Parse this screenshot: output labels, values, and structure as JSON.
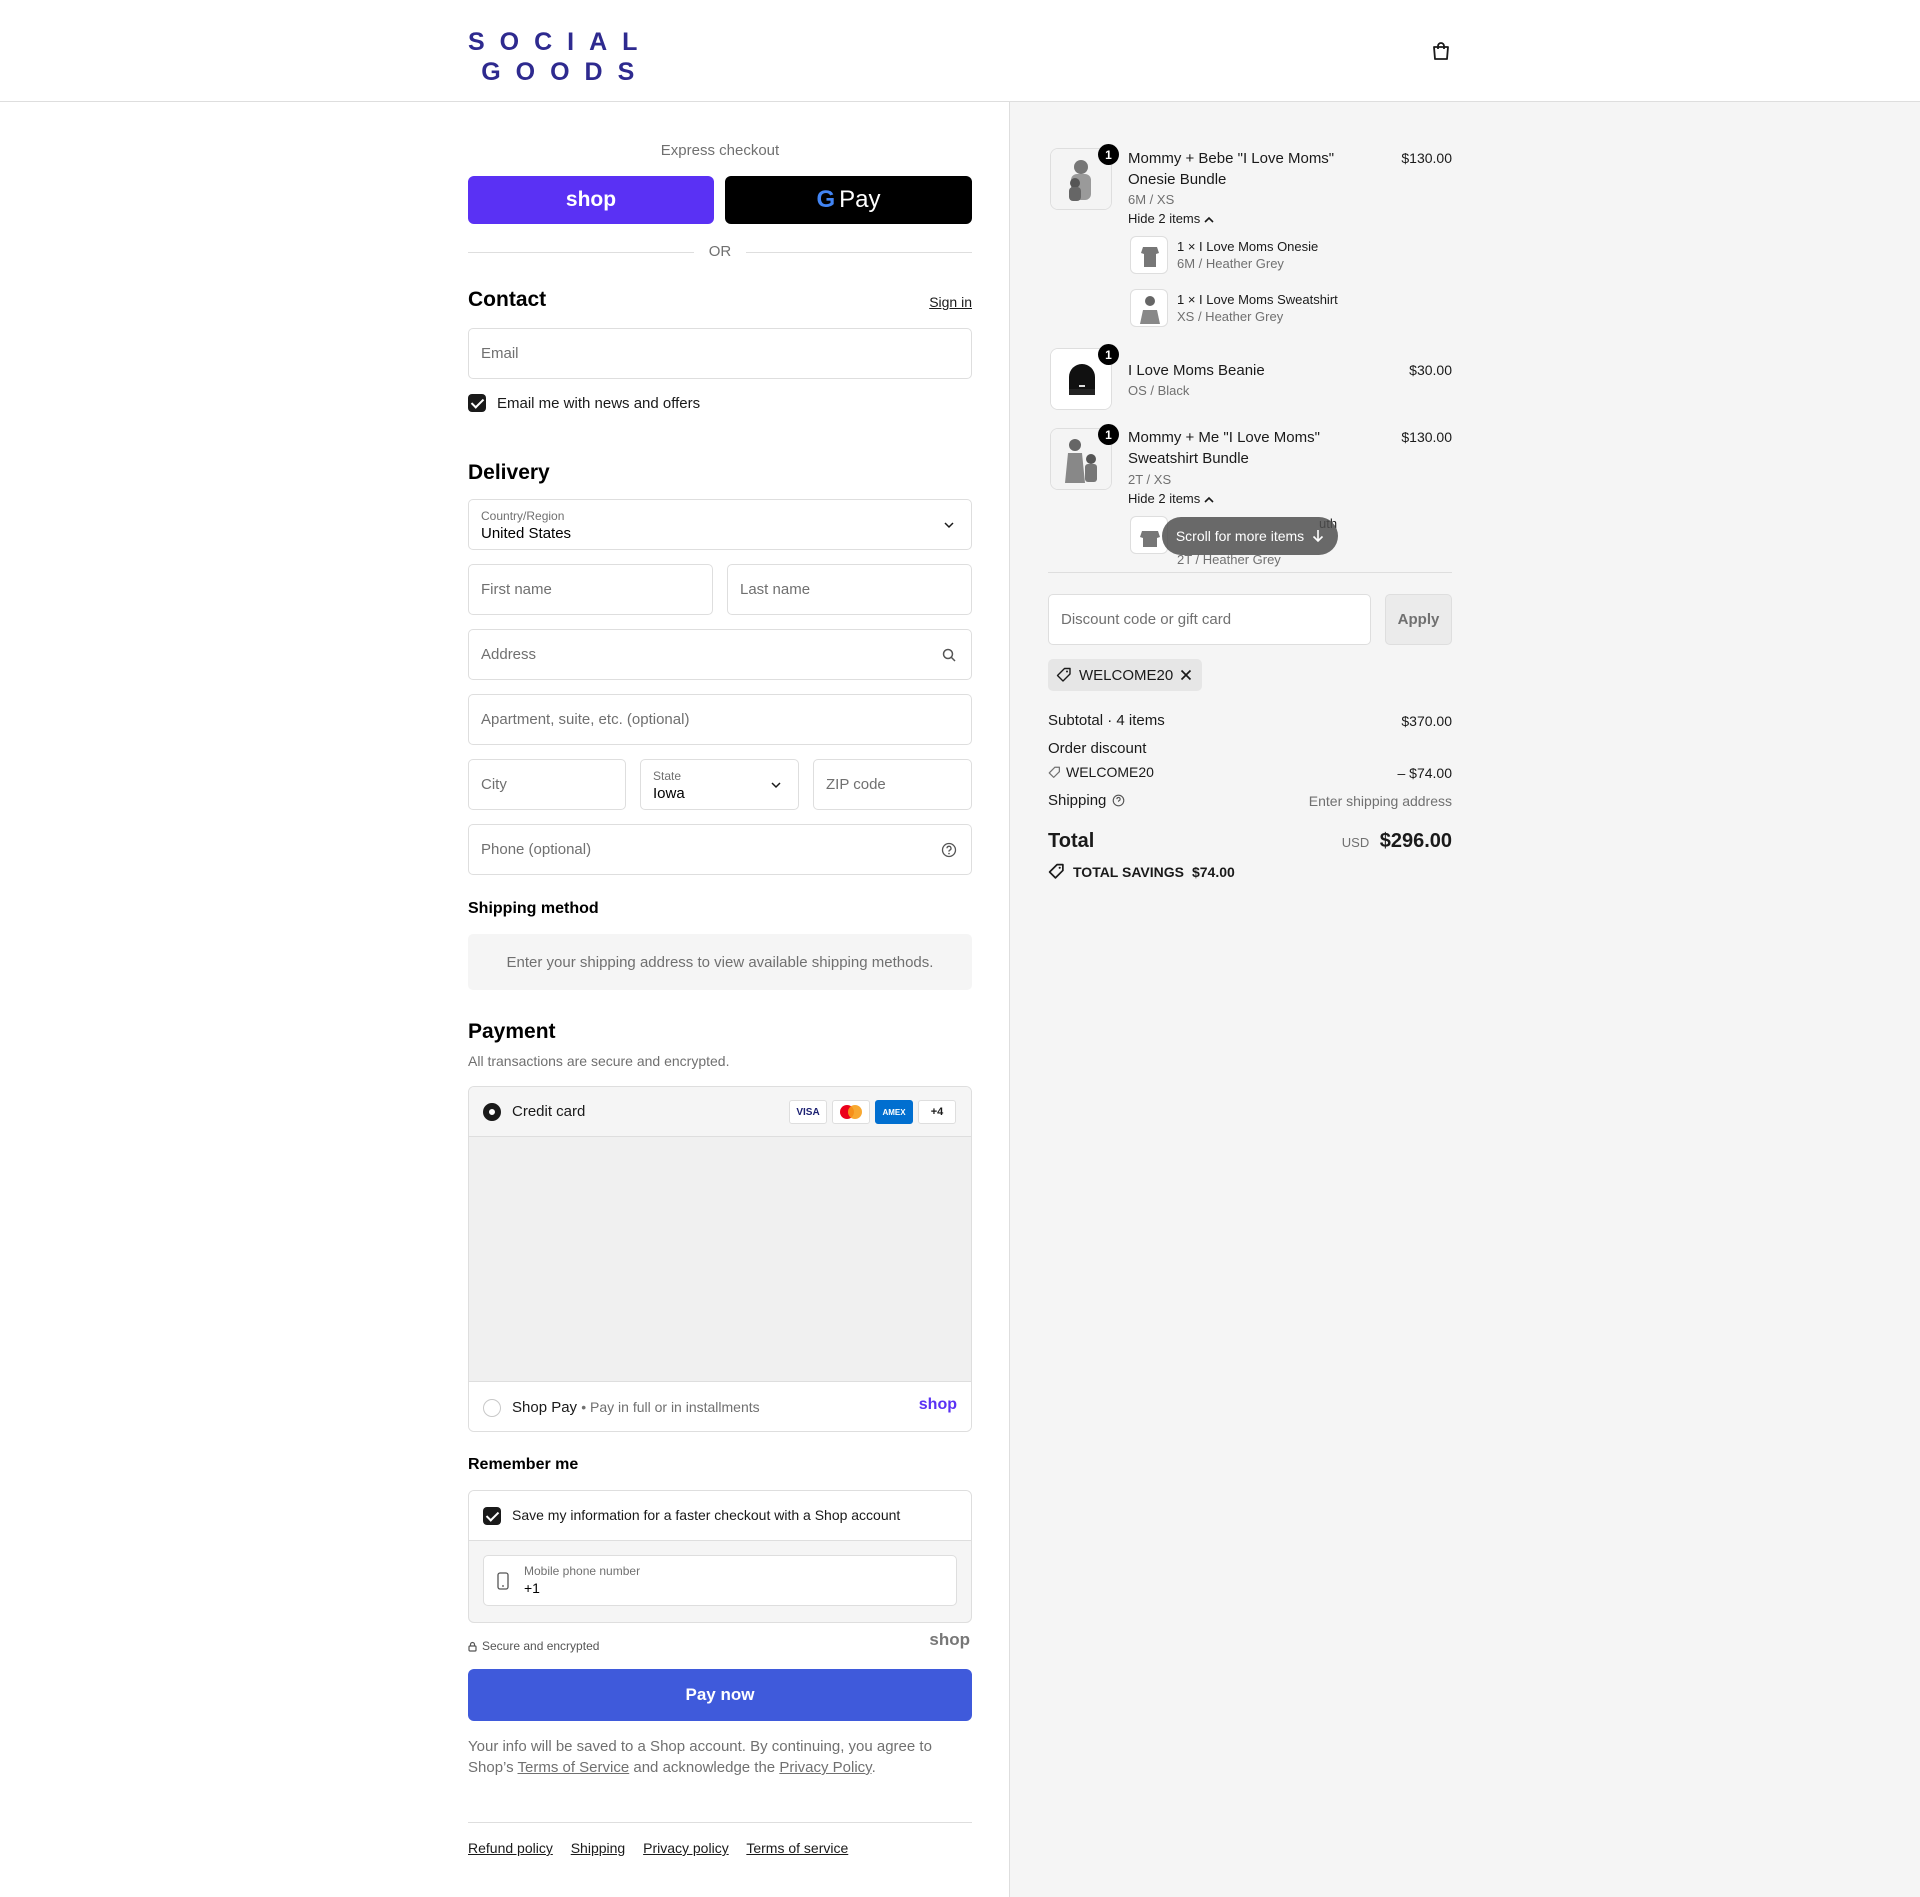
{
  "brand": {
    "line1": "SOCIAL",
    "line2": "GOODS",
    "color": "#2e2a8f"
  },
  "header": {
    "cart_icon": "shopping-bag-icon"
  },
  "express": {
    "label": "Express checkout",
    "shop_label": "shop",
    "gpay_g": "G",
    "gpay_label": "Pay",
    "or_label": "OR"
  },
  "contact": {
    "title": "Contact",
    "sign_in": "Sign in",
    "email_placeholder": "Email",
    "news_label": "Email me with news and offers",
    "news_checked": true
  },
  "delivery": {
    "title": "Delivery",
    "country_label": "Country/Region",
    "country_value": "United States",
    "first_name_placeholder": "First name",
    "last_name_placeholder": "Last name",
    "address_placeholder": "Address",
    "apartment_placeholder": "Apartment, suite, etc. (optional)",
    "city_placeholder": "City",
    "state_label": "State",
    "state_value": "Iowa",
    "zip_placeholder": "ZIP code",
    "phone_placeholder": "Phone (optional)"
  },
  "shipping_method": {
    "title": "Shipping method",
    "message": "Enter your shipping address to view available shipping methods."
  },
  "payment": {
    "title": "Payment",
    "subtitle": "All transactions are secure and encrypted.",
    "credit_card_label": "Credit card",
    "card_logos": [
      "VISA",
      "MC",
      "AMEX",
      "+4"
    ],
    "shop_pay_label": "Shop Pay",
    "shop_pay_sub": "Pay in full or in installments",
    "shop_pay_logo": "shop"
  },
  "remember": {
    "title": "Remember me",
    "save_label": "Save my information for a faster checkout with a Shop account",
    "save_checked": true,
    "phone_label": "Mobile phone number",
    "phone_value": "+1",
    "secure_label": "Secure and encrypted",
    "shop_logo": "shop"
  },
  "pay_now_label": "Pay now",
  "legal": {
    "pre": "Your info will be saved to a Shop account. By continuing, you agree to Shop’s",
    "tos": "Terms of Service",
    "mid": "and acknowledge the",
    "privacy": "Privacy Policy",
    "end": "."
  },
  "footer_links": [
    "Refund policy",
    "Shipping",
    "Privacy policy",
    "Terms of service"
  ],
  "order": {
    "items": [
      {
        "qty": "1",
        "name": "Mommy + Bebe \"I Love Moms\" Onesie Bundle",
        "variant": "6M / XS",
        "price": "$130.00",
        "toggle": "Hide 2 items",
        "sub_items": [
          {
            "name": "1 × I Love Moms Onesie",
            "variant": "6M / Heather Grey"
          },
          {
            "name": "1 × I Love Moms Sweatshirt",
            "variant": "XS / Heather Grey"
          }
        ]
      },
      {
        "qty": "1",
        "name": "I Love Moms Beanie",
        "variant": "OS / Black",
        "price": "$30.00"
      },
      {
        "qty": "1",
        "name": "Mommy + Me \"I Love Moms\" Sweatshirt Bundle",
        "variant": "2T / XS",
        "price": "$130.00",
        "toggle": "Hide 2 items",
        "sub_items": [
          {
            "name": "uth",
            "variant": "2T / Heather Grey"
          }
        ]
      }
    ],
    "scroll_hint": "Scroll for more items",
    "discount_placeholder": "Discount code or gift card",
    "apply_label": "Apply",
    "applied_code": "WELCOME20",
    "subtotal_label": "Subtotal · 4 items",
    "subtotal_value": "$370.00",
    "order_discount_label": "Order discount",
    "discount_code": "WELCOME20",
    "discount_value": "– $74.00",
    "shipping_label": "Shipping",
    "shipping_value": "Enter shipping address",
    "total_label": "Total",
    "currency": "USD",
    "total_value": "$296.00",
    "savings_label": "TOTAL SAVINGS",
    "savings_value": "$74.00"
  }
}
